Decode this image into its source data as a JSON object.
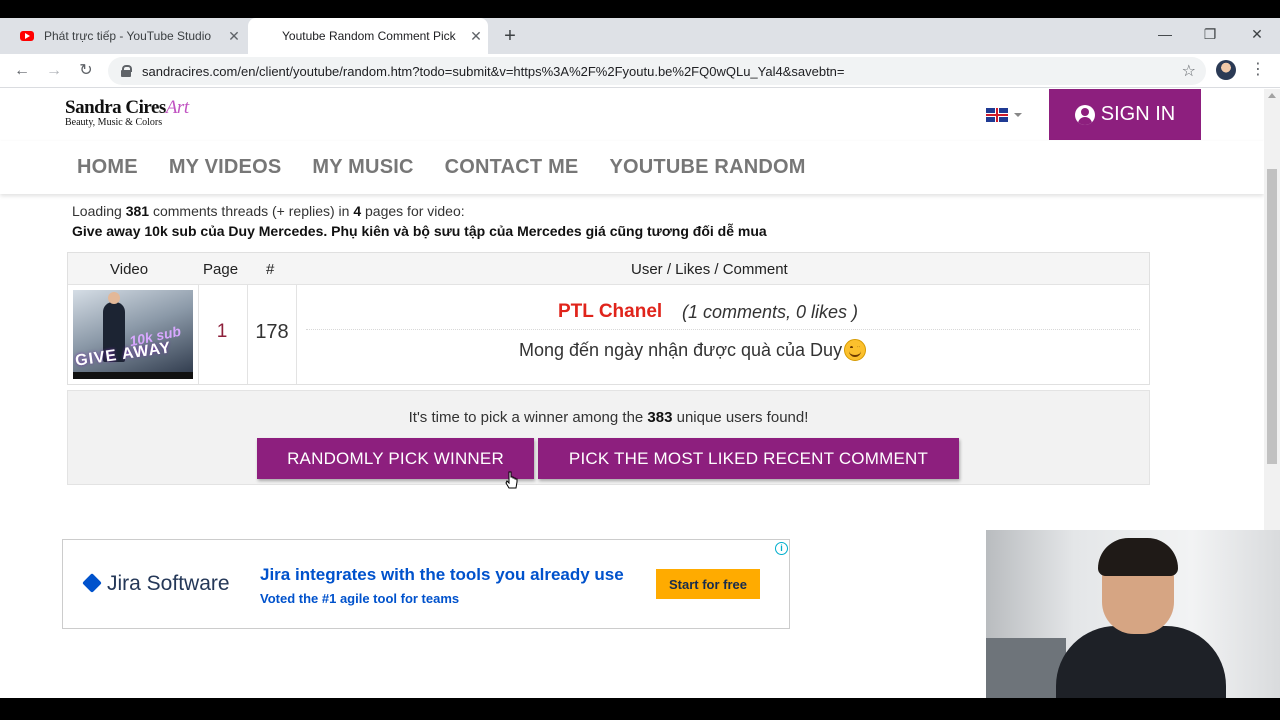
{
  "browser": {
    "tabs": [
      {
        "title": "Phát trực tiếp - YouTube Studio",
        "close": "✕"
      },
      {
        "title": "Youtube Random Comment Pick",
        "close": "✕"
      }
    ],
    "new_tab": "+",
    "window_controls": {
      "minimize": "—",
      "restore": "❐",
      "close": "✕"
    },
    "nav": {
      "back": "←",
      "forward": "→",
      "reload": "↻"
    },
    "url": "sandracires.com/en/client/youtube/random.htm?todo=submit&v=https%3A%2F%2Fyoutu.be%2FQ0wQLu_Yal4&savebtn=",
    "bookmark_icon": "☆",
    "menu_icon": "⋮"
  },
  "site": {
    "logo": {
      "name": "Sandra Cires",
      "art": "Art",
      "tagline": "Beauty, Music & Colors"
    },
    "signin_label": "SIGN IN",
    "nav": [
      "HOME",
      "MY VIDEOS",
      "MY MUSIC",
      "CONTACT ME",
      "YOUTUBE RANDOM"
    ]
  },
  "info": {
    "prefix": "Loading",
    "thread_count": "381",
    "mid": "comments threads (+ replies) in",
    "pages": "4",
    "suffix": "pages for video:",
    "video_title": "Give away 10k sub của Duy Mercedes. Phụ kiên và bộ sưu tập của Mercedes giá cũng tương đối dễ mua"
  },
  "table": {
    "headers": {
      "video": "Video",
      "page": "Page",
      "num": "#",
      "ulc": "User / Likes / Comment"
    },
    "row": {
      "thumb_text1": "10k sub",
      "thumb_text2": "GIVE AWAY",
      "page": "1",
      "num": "178",
      "user": "PTL Chanel",
      "meta": "(1 comments, 0 likes )",
      "comment": "Mong đến ngày nhận được quà của Duy"
    }
  },
  "pick": {
    "prefix": "It's time to pick a winner among the",
    "count": "383",
    "suffix": "unique users found!",
    "btn_random": "RANDOMLY PICK WINNER",
    "btn_liked": "PICK THE MOST LIKED RECENT COMMENT"
  },
  "ad": {
    "info": "i",
    "brand": "Jira Software",
    "headline": "Jira integrates with the tools you already use",
    "sub": "Voted the #1 agile tool for teams",
    "cta": "Start for free"
  },
  "colors": {
    "brand": "#8d1f7e",
    "username": "#e0241b",
    "ad_blue": "#0052cc",
    "ad_cta": "#ffab00"
  }
}
